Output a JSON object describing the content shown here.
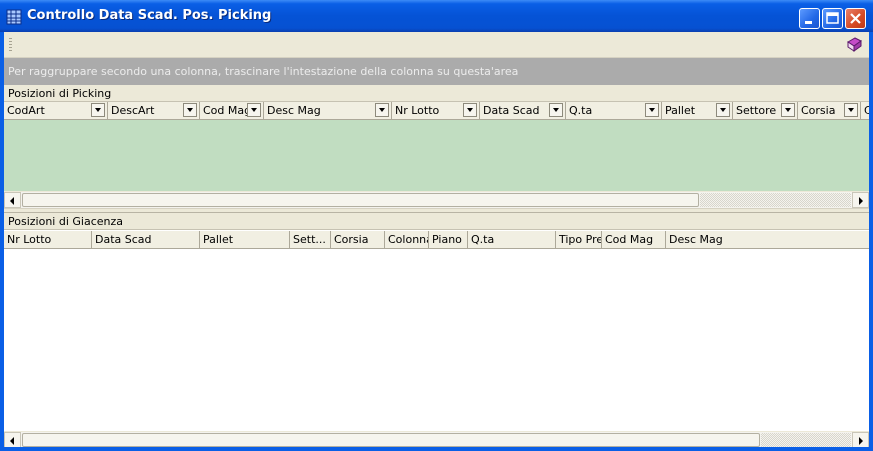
{
  "window": {
    "title": "Controllo Data Scad. Pos. Picking",
    "app_icon": "grid-app-icon",
    "buttons": [
      "minimize",
      "maximize",
      "close"
    ]
  },
  "toolbar": {
    "book_icon": "book-icon"
  },
  "group_panel": {
    "text": "Per raggruppare secondo una colonna, trascinare l'intestazione della colonna su questa'area"
  },
  "picking": {
    "caption": "Posizioni di Picking",
    "columns": [
      "CodArt",
      "DescArt",
      "Cod Mag",
      "Desc Mag",
      "Nr Lotto",
      "Data Scad",
      "Q.ta",
      "Pallet",
      "Settore",
      "Corsia",
      "C"
    ],
    "row_color": "#c1ddc1"
  },
  "giacenza": {
    "caption": "Posizioni di Giacenza",
    "columns": [
      "Nr Lotto",
      "Data Scad",
      "Pallet",
      "Sett...",
      "Corsia",
      "Colonna",
      "Piano",
      "Q.ta",
      "Tipo Prel",
      "Cod Mag",
      "Desc Mag"
    ]
  },
  "colors": {
    "titlebar": "#0553d6",
    "toolbar": "#ece9d8",
    "group_panel": "#ababab"
  }
}
